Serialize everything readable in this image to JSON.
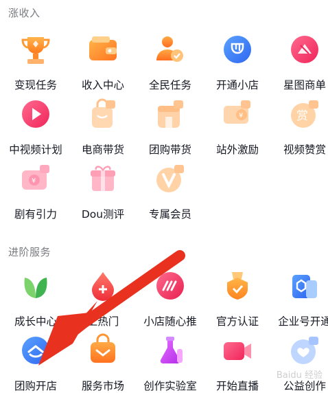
{
  "sections": [
    {
      "title": "涨收入",
      "items": [
        {
          "label": "变现任务",
          "icon": "trophy-icon"
        },
        {
          "label": "收入中心",
          "icon": "wallet-icon"
        },
        {
          "label": "全民任务",
          "icon": "people-icon"
        },
        {
          "label": "开通小店",
          "icon": "shop-icon"
        },
        {
          "label": "星图商单",
          "icon": "star-map-icon"
        },
        {
          "label": "中视频计划",
          "icon": "play-icon"
        },
        {
          "label": "电商带货",
          "icon": "shopping-bag-icon"
        },
        {
          "label": "团购带货",
          "icon": "group-buy-icon"
        },
        {
          "label": "站外激励",
          "icon": "ticket-icon"
        },
        {
          "label": "视频赞赏",
          "icon": "reward-icon"
        },
        {
          "label": "剧有引力",
          "icon": "drama-icon"
        },
        {
          "label": "Dou测评",
          "icon": "gift-box-icon"
        },
        {
          "label": "专属会员",
          "icon": "vip-icon"
        }
      ]
    },
    {
      "title": "进阶服务",
      "items": [
        {
          "label": "成长中心",
          "icon": "leaf-icon"
        },
        {
          "label": "上热门",
          "icon": "fire-drop-icon"
        },
        {
          "label": "小店随心推",
          "icon": "boost-icon"
        },
        {
          "label": "官方认证",
          "icon": "badge-icon"
        },
        {
          "label": "企业号开通",
          "icon": "enterprise-icon"
        },
        {
          "label": "团购开店",
          "icon": "store-open-icon"
        },
        {
          "label": "服务市场",
          "icon": "service-bag-icon"
        },
        {
          "label": "创作实验室",
          "icon": "flask-icon"
        },
        {
          "label": "开始直播",
          "icon": "live-camera-icon"
        },
        {
          "label": "公益创作",
          "icon": "charity-icon"
        }
      ]
    }
  ],
  "colors": {
    "orange": "#FF8A2B",
    "blue": "#3A7BFF",
    "pink": "#FF3D6E",
    "red_arrow": "#E8321F"
  },
  "watermark": "Baidu 经验"
}
